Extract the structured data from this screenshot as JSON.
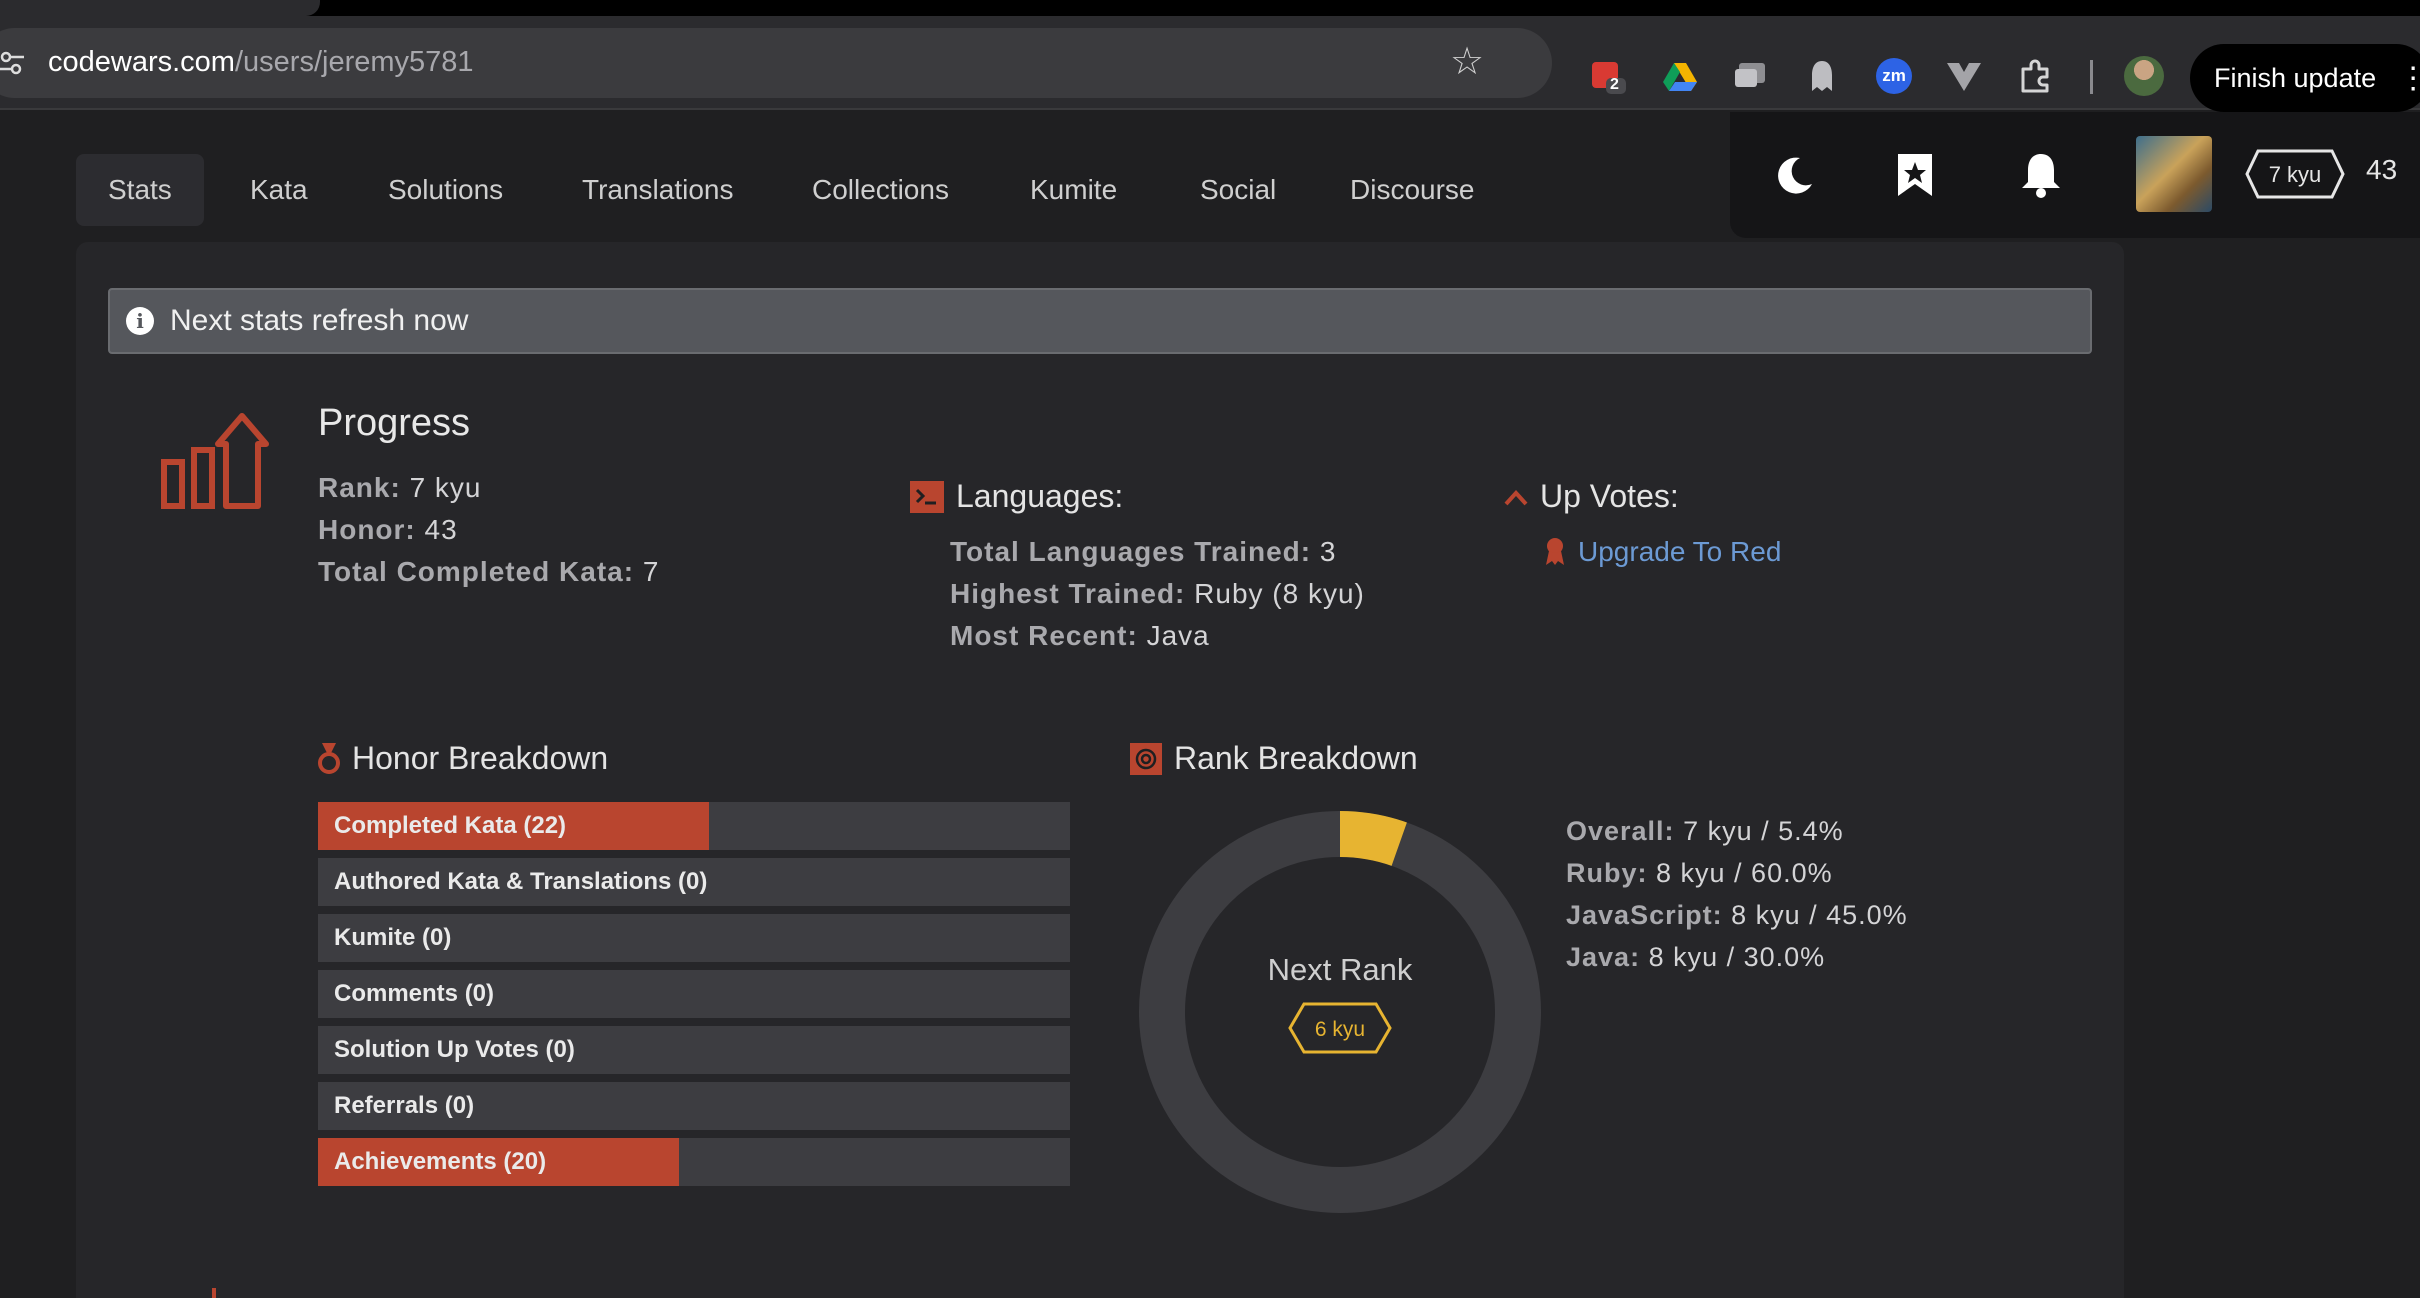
{
  "browser": {
    "url_host": "codewars.com",
    "url_path": "/users/jeremy5781",
    "extension_badge": "2",
    "zoom_ext_label": "zm",
    "finish_update_label": "Finish update"
  },
  "nav": {
    "tabs": [
      "Stats",
      "Kata",
      "Solutions",
      "Translations",
      "Collections",
      "Kumite",
      "Social",
      "Discourse"
    ],
    "active_tab": "Stats"
  },
  "userbar": {
    "rank": "7 kyu",
    "honor": "43"
  },
  "notice": "Next stats refresh now",
  "progress": {
    "title": "Progress",
    "rank_label": "Rank:",
    "rank_value": "7 kyu",
    "honor_label": "Honor:",
    "honor_value": "43",
    "completed_label": "Total Completed Kata:",
    "completed_value": "7"
  },
  "languages": {
    "title": "Languages:",
    "trained_label": "Total Languages Trained:",
    "trained_value": "3",
    "highest_label": "Highest Trained:",
    "highest_value": "Ruby (8 kyu)",
    "recent_label": "Most Recent:",
    "recent_value": "Java"
  },
  "upvotes": {
    "title": "Up Votes:",
    "link": "Upgrade To Red"
  },
  "honor_breakdown": {
    "title": "Honor Breakdown",
    "items": [
      {
        "label": "Completed Kata (22)",
        "fraction": 0.52
      },
      {
        "label": "Authored Kata & Translations (0)",
        "fraction": 0
      },
      {
        "label": "Kumite (0)",
        "fraction": 0
      },
      {
        "label": "Comments (0)",
        "fraction": 0
      },
      {
        "label": "Solution Up Votes (0)",
        "fraction": 0
      },
      {
        "label": "Referrals (0)",
        "fraction": 0
      },
      {
        "label": "Achievements (20)",
        "fraction": 0.48
      }
    ]
  },
  "rank_breakdown": {
    "title": "Rank Breakdown",
    "donut_center_label": "Next Rank",
    "next_rank": "6 kyu",
    "overall_progress_fraction": 0.054,
    "rows": [
      {
        "k": "Overall:",
        "v": "7 kyu / 5.4%"
      },
      {
        "k": "Ruby:",
        "v": "8 kyu / 60.0%"
      },
      {
        "k": "JavaScript:",
        "v": "8 kyu / 45.0%"
      },
      {
        "k": "Java:",
        "v": "8 kyu / 30.0%"
      }
    ]
  },
  "colors": {
    "accent_red": "#b9452f",
    "gold": "#e7b431",
    "link_blue": "#6c9ad4"
  }
}
